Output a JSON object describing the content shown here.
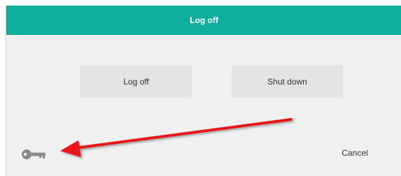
{
  "dialog": {
    "title": "Log off",
    "accent_color": "#0fae9c",
    "buttons": {
      "log_off_label": "Log off",
      "shut_down_label": "Shut down"
    },
    "cancel_label": "Cancel",
    "footer_icon": "key-icon"
  },
  "annotation": {
    "type": "arrow",
    "color": "#e8141a",
    "points_to": "key-icon"
  }
}
